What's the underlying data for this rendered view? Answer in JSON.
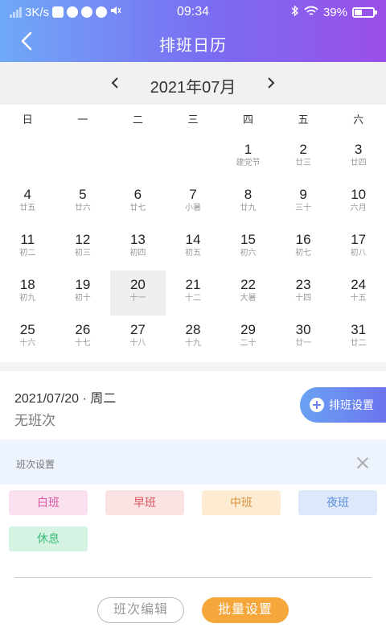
{
  "status_bar": {
    "net_speed": "3K/s",
    "time": "09:34",
    "battery_pct": "39%",
    "battery_level": 0.39
  },
  "header": {
    "title": "排班日历"
  },
  "month_nav": {
    "label": "2021年07月"
  },
  "weekdays": [
    "日",
    "一",
    "二",
    "三",
    "四",
    "五",
    "六"
  ],
  "days": [
    {
      "n": "",
      "l": ""
    },
    {
      "n": "",
      "l": ""
    },
    {
      "n": "",
      "l": ""
    },
    {
      "n": "",
      "l": ""
    },
    {
      "n": "1",
      "l": "建党节"
    },
    {
      "n": "2",
      "l": "廿三"
    },
    {
      "n": "3",
      "l": "廿四"
    },
    {
      "n": "4",
      "l": "廿五"
    },
    {
      "n": "5",
      "l": "廿六"
    },
    {
      "n": "6",
      "l": "廿七"
    },
    {
      "n": "7",
      "l": "小暑"
    },
    {
      "n": "8",
      "l": "廿九"
    },
    {
      "n": "9",
      "l": "三十"
    },
    {
      "n": "10",
      "l": "六月"
    },
    {
      "n": "11",
      "l": "初二"
    },
    {
      "n": "12",
      "l": "初三"
    },
    {
      "n": "13",
      "l": "初四"
    },
    {
      "n": "14",
      "l": "初五"
    },
    {
      "n": "15",
      "l": "初六"
    },
    {
      "n": "16",
      "l": "初七"
    },
    {
      "n": "17",
      "l": "初八"
    },
    {
      "n": "18",
      "l": "初九"
    },
    {
      "n": "19",
      "l": "初十"
    },
    {
      "n": "20",
      "l": "十一",
      "selected": true
    },
    {
      "n": "21",
      "l": "十二"
    },
    {
      "n": "22",
      "l": "大暑"
    },
    {
      "n": "23",
      "l": "十四"
    },
    {
      "n": "24",
      "l": "十五"
    },
    {
      "n": "25",
      "l": "十六"
    },
    {
      "n": "26",
      "l": "十七"
    },
    {
      "n": "27",
      "l": "十八"
    },
    {
      "n": "28",
      "l": "十九"
    },
    {
      "n": "29",
      "l": "二十"
    },
    {
      "n": "30",
      "l": "廿一"
    },
    {
      "n": "31",
      "l": "廿二"
    }
  ],
  "selected_info": {
    "date": "2021/07/20 · 周二",
    "shift": "无班次",
    "schedule_button": "排班设置"
  },
  "shift_panel": {
    "title": "班次设置",
    "shifts": [
      {
        "label": "白班",
        "bg": "#fbe1f0",
        "fg": "#d5559f"
      },
      {
        "label": "早班",
        "bg": "#fbe3e4",
        "fg": "#d9545d"
      },
      {
        "label": "中班",
        "bg": "#fdebd2",
        "fg": "#d9943e"
      },
      {
        "label": "夜班",
        "bg": "#dde9fb",
        "fg": "#5a8edc"
      },
      {
        "label": "休息",
        "bg": "#d5f3e3",
        "fg": "#3dbb77"
      }
    ],
    "edit_button": "班次编辑",
    "batch_button": "批量设置"
  }
}
